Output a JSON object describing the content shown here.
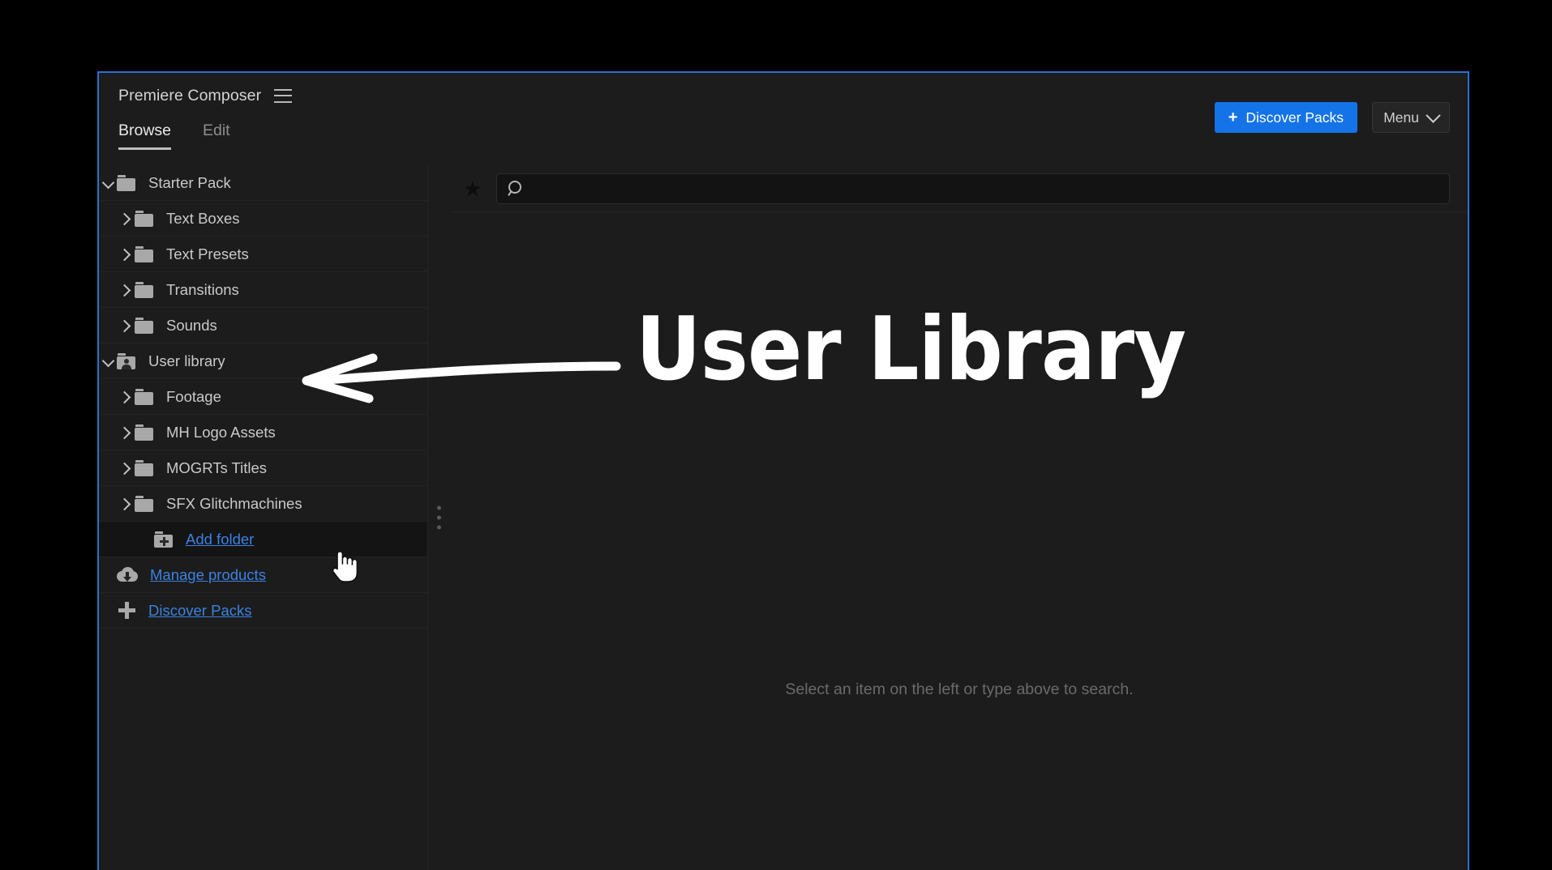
{
  "window": {
    "app_title": "Premiere Composer",
    "menu_icon": "hamburger-icon"
  },
  "tabs": [
    {
      "label": "Browse",
      "active": true
    },
    {
      "label": "Edit",
      "active": false
    }
  ],
  "header": {
    "discover_packs_label": "Discover Packs",
    "discover_packs_plus": "+",
    "discover_packs_color": "#1473e6",
    "menu_label": "Menu"
  },
  "sidebar": {
    "items": [
      {
        "label": "Starter Pack",
        "icon": "folder-icon",
        "twisty": "open",
        "depth": 0,
        "link": false,
        "hovered": false
      },
      {
        "label": "Text Boxes",
        "icon": "folder-icon",
        "twisty": "closed",
        "depth": 1,
        "link": false,
        "hovered": false
      },
      {
        "label": "Text Presets",
        "icon": "folder-icon",
        "twisty": "closed",
        "depth": 1,
        "link": false,
        "hovered": false
      },
      {
        "label": "Transitions",
        "icon": "folder-icon",
        "twisty": "closed",
        "depth": 1,
        "link": false,
        "hovered": false
      },
      {
        "label": "Sounds",
        "icon": "folder-icon",
        "twisty": "closed",
        "depth": 1,
        "link": false,
        "hovered": false
      },
      {
        "label": "User library",
        "icon": "user-folder-icon",
        "twisty": "open",
        "depth": 0,
        "link": false,
        "hovered": false
      },
      {
        "label": "Footage",
        "icon": "folder-icon",
        "twisty": "closed",
        "depth": 1,
        "link": false,
        "hovered": false
      },
      {
        "label": "MH Logo Assets",
        "icon": "folder-icon",
        "twisty": "closed",
        "depth": 1,
        "link": false,
        "hovered": false
      },
      {
        "label": "MOGRTs Titles",
        "icon": "folder-icon",
        "twisty": "closed",
        "depth": 1,
        "link": false,
        "hovered": false
      },
      {
        "label": "SFX Glitchmachines",
        "icon": "folder-icon",
        "twisty": "closed",
        "depth": 1,
        "link": false,
        "hovered": false
      },
      {
        "label": "Add folder",
        "icon": "folder-plus-icon",
        "twisty": "none",
        "depth": 2,
        "link": true,
        "hovered": true
      },
      {
        "label": "Manage products",
        "icon": "cloud-download-icon",
        "twisty": "none",
        "depth": 0,
        "link": true,
        "hovered": false
      },
      {
        "label": "Discover Packs",
        "icon": "plus-icon",
        "twisty": "none",
        "depth": 0,
        "link": true,
        "hovered": false
      }
    ],
    "link_color": "#3b82e0"
  },
  "search": {
    "value": "",
    "placeholder": "",
    "star_icon": "star-icon",
    "magnifier_icon": "search-icon"
  },
  "content": {
    "empty_state": "Select an item on the left or type above to search."
  },
  "annotation": {
    "text": "User Library",
    "arrow": "left-arrow-annotation",
    "color": "#ffffff"
  },
  "cursor": {
    "icon": "pointing-hand-cursor"
  }
}
